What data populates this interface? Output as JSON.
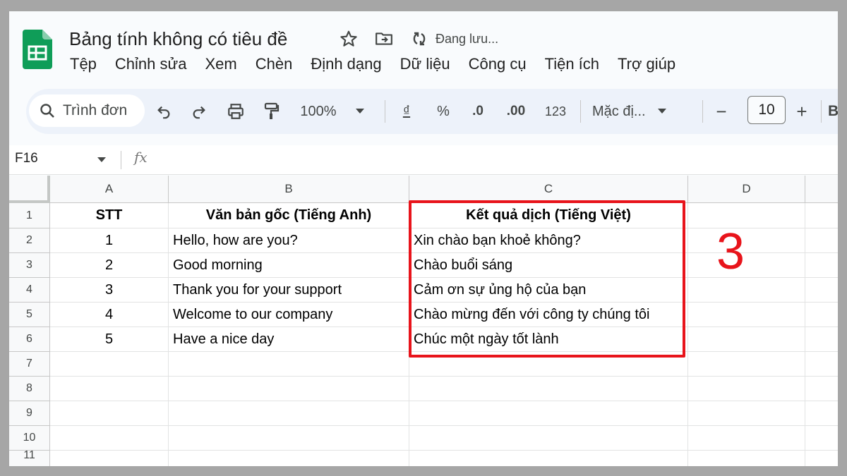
{
  "doc": {
    "title": "Bảng tính không có tiêu đề",
    "saving_status": "Đang lưu..."
  },
  "menu": [
    "Tệp",
    "Chỉnh sửa",
    "Xem",
    "Chèn",
    "Định dạng",
    "Dữ liệu",
    "Công cụ",
    "Tiện ích",
    "Trợ giúp"
  ],
  "toolbar": {
    "search_label": "Trình đơn",
    "zoom": "100%",
    "currency": "₫",
    "percent": "%",
    "decrease_decimal": ".0",
    "increase_decimal": ".00",
    "number_format": "123",
    "font": "Mặc đị...",
    "minus": "−",
    "font_size": "10",
    "plus": "+",
    "bold": "B"
  },
  "formula_bar": {
    "cell_ref": "F16",
    "fx": "fx"
  },
  "columns": [
    "A",
    "B",
    "C",
    "D"
  ],
  "rows": [
    "1",
    "2",
    "3",
    "4",
    "5",
    "6",
    "7",
    "8",
    "9",
    "10",
    "11"
  ],
  "table": {
    "headers": [
      "STT",
      "Văn bản gốc (Tiếng Anh)",
      "Kết quả dịch (Tiếng Việt)"
    ],
    "rows": [
      [
        "1",
        "Hello, how are you?",
        "Xin chào bạn khoẻ không?"
      ],
      [
        "2",
        "Good morning",
        "Chào buổi sáng"
      ],
      [
        "3",
        "Thank you for your support",
        "Cảm ơn sự ủng hộ của bạn"
      ],
      [
        "4",
        "Welcome to our company",
        "Chào mừng đến với công ty chúng tôi"
      ],
      [
        "5",
        "Have a nice day",
        "Chúc một ngày tốt lành"
      ]
    ]
  },
  "annotation": "3",
  "colors": {
    "highlight": "#e8141b",
    "sheets_green": "#0f9d58"
  }
}
